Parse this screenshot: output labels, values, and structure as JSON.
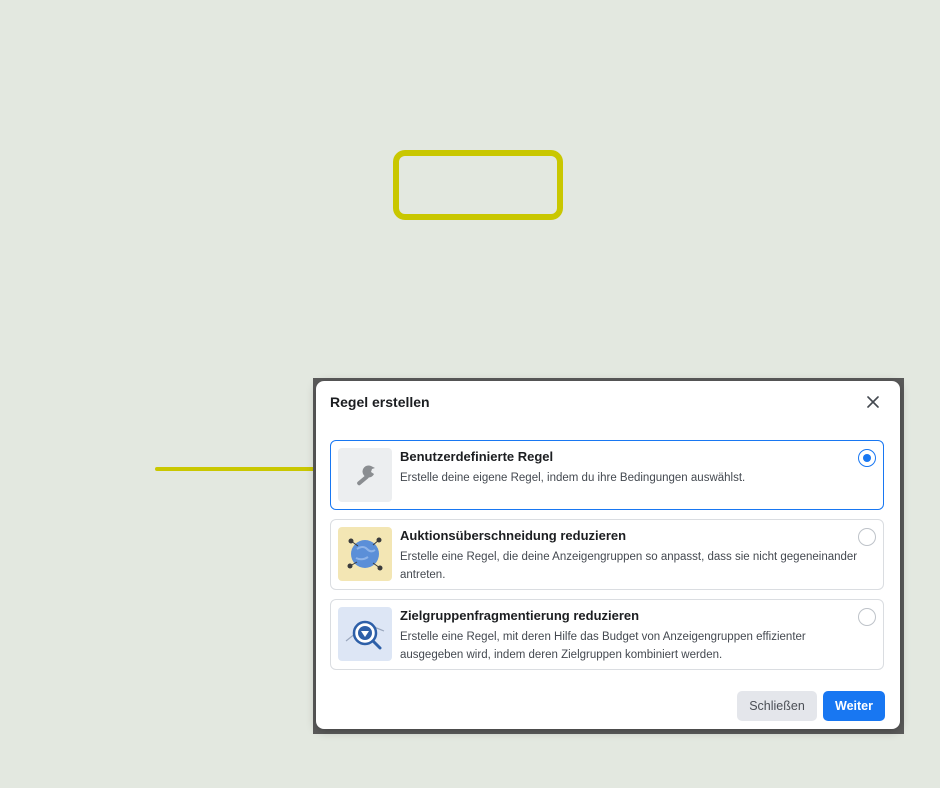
{
  "dialog": {
    "title": "Regel erstellen",
    "options": [
      {
        "title": "Benutzerdefinierte Regel",
        "description": "Erstelle deine eigene Regel, indem du ihre Bedingungen auswählst.",
        "icon": "wrench-icon",
        "selected": true
      },
      {
        "title": "Auktionsüberschneidung reduzieren",
        "description": "Erstelle eine Regel, die deine Anzeigengruppen so anpasst, dass sie nicht gegeneinander antreten.",
        "icon": "globe-network-icon",
        "selected": false
      },
      {
        "title": "Zielgruppenfragmentierung reduzieren",
        "description": "Erstelle eine Regel, mit deren Hilfe das Budget von Anzeigengruppen effizienter ausgegeben wird, indem deren Zielgruppen kombiniert werden.",
        "icon": "target-magnifier-icon",
        "selected": false
      }
    ],
    "buttons": {
      "close_label": "Schließen",
      "next_label": "Weiter"
    }
  },
  "colors": {
    "background": "#e3e8e0",
    "highlight": "#c9c700",
    "accent": "#1877f2"
  }
}
